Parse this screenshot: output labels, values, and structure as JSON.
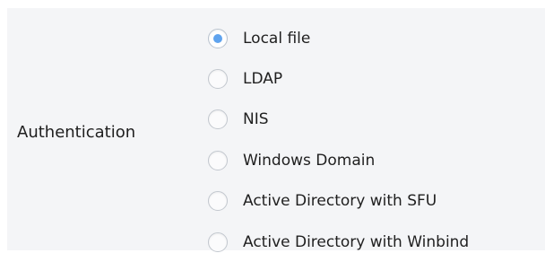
{
  "authentication": {
    "label": "Authentication",
    "selected_index": 0,
    "accent_color": "#5fa3ee",
    "options": [
      {
        "label": "Local file",
        "checked": true
      },
      {
        "label": "LDAP",
        "checked": false
      },
      {
        "label": "NIS",
        "checked": false
      },
      {
        "label": "Windows Domain",
        "checked": false
      },
      {
        "label": "Active Directory with SFU",
        "checked": false
      },
      {
        "label": "Active Directory with Winbind",
        "checked": false
      }
    ]
  }
}
